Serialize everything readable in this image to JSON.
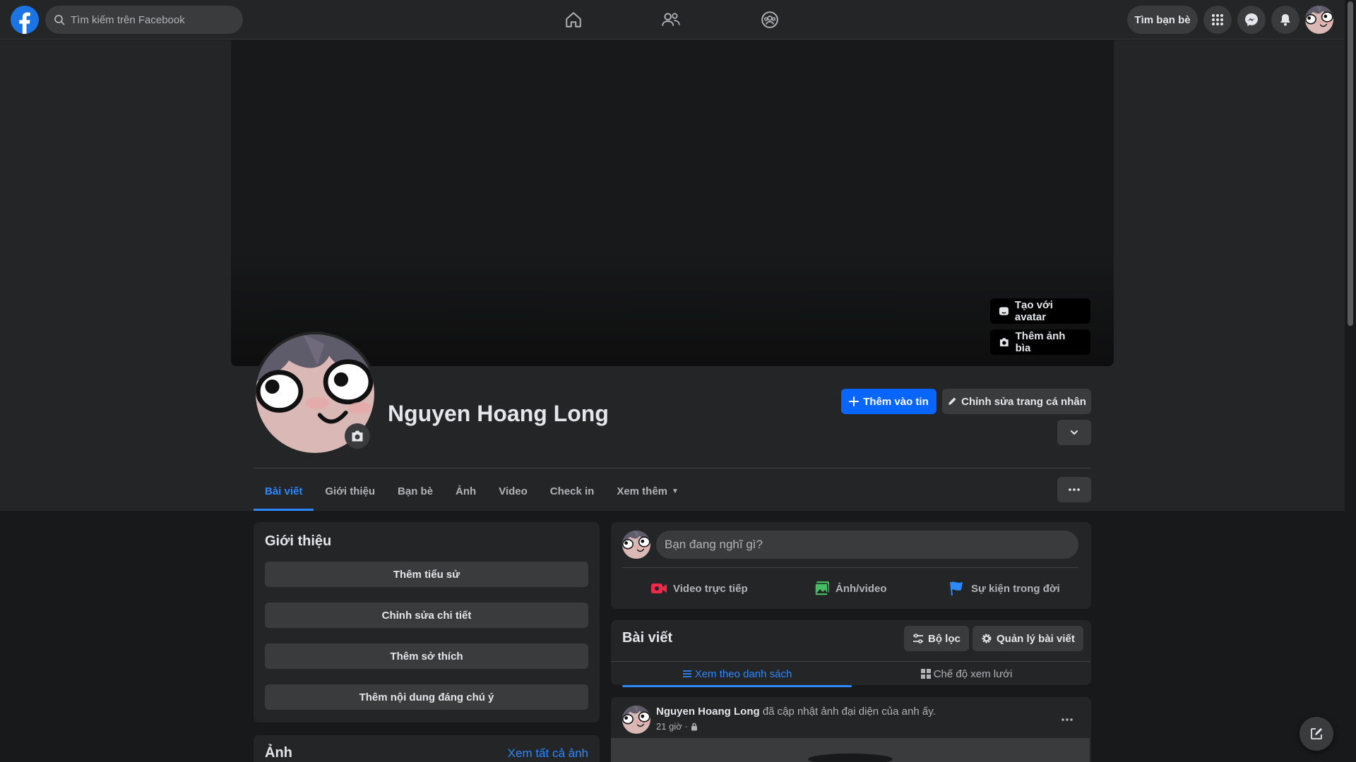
{
  "topbar": {
    "search_placeholder": "Tìm kiếm trên Facebook",
    "find_friends_label": "Tìm bạn bè",
    "icons": [
      "facebook-logo",
      "search-icon",
      "home-icon",
      "friends-icon",
      "groups-icon",
      "menu-grid-icon",
      "messenger-icon",
      "bell-icon",
      "avatar"
    ]
  },
  "cover": {
    "create_avatar_label": "Tạo với avatar",
    "add_cover_label": "Thêm ảnh bìa"
  },
  "profile": {
    "name": "Nguyen Hoang Long",
    "add_to_story_label": "Thêm vào tin",
    "edit_profile_label": "Chỉnh sửa trang cá nhân"
  },
  "tabs": [
    {
      "label": "Bài viết",
      "active": true
    },
    {
      "label": "Giới thiệu"
    },
    {
      "label": "Bạn bè"
    },
    {
      "label": "Ảnh"
    },
    {
      "label": "Video"
    },
    {
      "label": "Check in"
    },
    {
      "label": "Xem thêm"
    }
  ],
  "intro": {
    "title": "Giới thiệu",
    "buttons": [
      "Thêm tiểu sử",
      "Chỉnh sửa chi tiết",
      "Thêm sở thích",
      "Thêm nội dung đáng chú ý"
    ]
  },
  "photos": {
    "title": "Ảnh",
    "see_all_label": "Xem tất cả ảnh"
  },
  "composer": {
    "placeholder": "Bạn đang nghĩ gì?",
    "actions": [
      "Video trực tiếp",
      "Ảnh/video",
      "Sự kiện trong đời"
    ]
  },
  "posts": {
    "title": "Bài viết",
    "filter_label": "Bộ lọc",
    "manage_label": "Quản lý bài viết",
    "list_view_label": "Xem theo danh sách",
    "grid_view_label": "Chế độ xem lưới"
  },
  "feed_item": {
    "author": "Nguyen Hoang Long",
    "action_text": "đã cập nhật ảnh đại diện của anh ấy.",
    "time": "21 giờ ·"
  },
  "colors": {
    "accent": "#0866ff",
    "link": "#2d88ff",
    "background": "#18191a",
    "surface": "#242526",
    "button": "#3a3b3c"
  }
}
